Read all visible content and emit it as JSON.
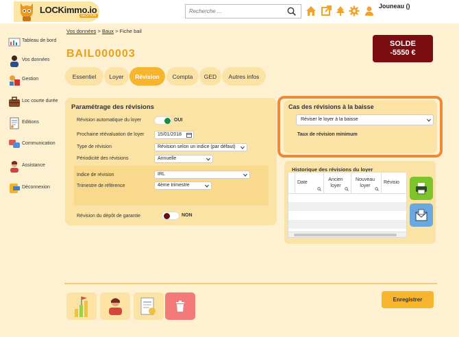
{
  "brand": {
    "name": "LOCKimmo.io",
    "sub": "GESTION"
  },
  "search": {
    "placeholder": "Recherche ..."
  },
  "user": {
    "name": "Jouneau ()"
  },
  "header_icons": [
    "home-icon",
    "external-link-icon",
    "tree-icon",
    "gear-icon",
    "user-icon"
  ],
  "sidebar": {
    "items": [
      {
        "label": "Tableau de bord",
        "icon": "dashboard-icon"
      },
      {
        "label": "Vos données",
        "icon": "person-icon"
      },
      {
        "label": "Gestion",
        "icon": "management-icon"
      },
      {
        "label": "Loc courte durée",
        "icon": "suitcase-icon"
      },
      {
        "label": "Editions",
        "icon": "document-icon"
      },
      {
        "label": "Communication",
        "icon": "chat-icon"
      },
      {
        "label": "Assistance",
        "icon": "support-icon"
      },
      {
        "label": "Déconnexion",
        "icon": "logout-icon"
      }
    ]
  },
  "breadcrumb": {
    "items": [
      "Vos données",
      "Baux",
      "Fiche bail"
    ],
    "sep": ">"
  },
  "page": {
    "title": "BAIL000003"
  },
  "solde": {
    "label": "SOLDE",
    "value": "-5550 €"
  },
  "tabs": [
    {
      "label": "Essentiel"
    },
    {
      "label": "Loyer"
    },
    {
      "label": "Révision"
    },
    {
      "label": "Compta"
    },
    {
      "label": "GED"
    },
    {
      "label": "Autres infos"
    }
  ],
  "params": {
    "title": "Paramétrage des révisions",
    "auto_label": "Révision automatique du loyer",
    "auto_value": "OUI",
    "next_label": "Prochaine réévaluation de loyer",
    "next_value": "15/01/2018",
    "type_label": "Type de révision",
    "type_value": "Révision selon un indice (par défaut)",
    "period_label": "Périodicité des révisions",
    "period_value": "Annuelle",
    "index_label": "Indice de révision",
    "index_value": "IRL",
    "quarter_label": "Trimestre de référence",
    "quarter_value": "4ème trimestre",
    "deposit_label": "Révision du dépôt de garantie",
    "deposit_value": "NON"
  },
  "baisse": {
    "title": "Cas des révisions à la baisse",
    "select_value": "Réviser le loyer à la baisse",
    "min_rate_label": "Taux de révision minimum"
  },
  "history": {
    "title": "Historique des révisions du loyer",
    "columns": [
      {
        "label": "Date"
      },
      {
        "label": "Ancien loyer"
      },
      {
        "label": "Nouveau loyer"
      },
      {
        "label": "Révisio"
      }
    ]
  },
  "footer": {
    "save_label": "Enregistrer"
  },
  "colors": {
    "accent": "#f6b42f",
    "solde": "#7b0d12",
    "highlight": "#ec8a35",
    "print": "#7dc42a",
    "mail": "#6ba8df",
    "delete": "#f27a7a"
  }
}
